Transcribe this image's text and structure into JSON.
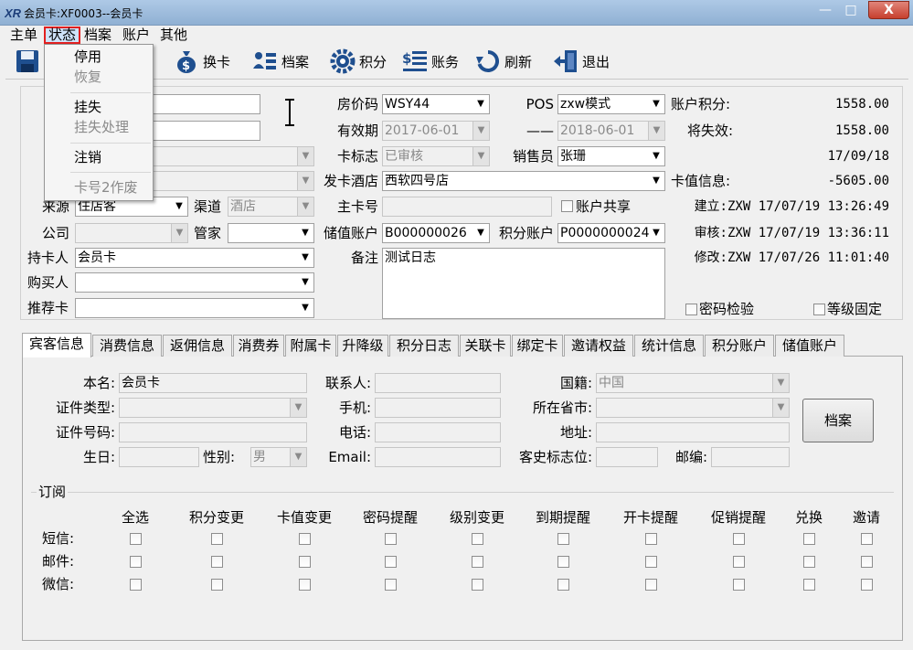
{
  "window": {
    "title": "会员卡:XF0003--会员卡",
    "minimize": "—",
    "maximize": "□",
    "close": "X"
  },
  "menubar": [
    "主单",
    "状态",
    "档案",
    "账户",
    "其他"
  ],
  "status_menu": {
    "items": [
      {
        "label": "停用",
        "enabled": true
      },
      {
        "label": "恢复",
        "enabled": false
      },
      {
        "label": "挂失",
        "enabled": true
      },
      {
        "label": "挂失处理",
        "enabled": false
      },
      {
        "label": "注销",
        "enabled": true
      },
      {
        "label": "卡号2作废",
        "enabled": false
      }
    ]
  },
  "toolbar": [
    {
      "label": "换卡",
      "icon": "money-bag-icon"
    },
    {
      "label": "档案",
      "icon": "profile-list-icon"
    },
    {
      "label": "积分",
      "icon": "gear-points-icon"
    },
    {
      "label": "账务",
      "icon": "dollar-lines-icon"
    },
    {
      "label": "刷新",
      "icon": "refresh-icon"
    },
    {
      "label": "退出",
      "icon": "exit-door-icon"
    }
  ],
  "form": {
    "source_label": "来源",
    "source_value": "住店客",
    "channel_label": "渠道",
    "channel_value": "酒店",
    "company_label": "公司",
    "company_value": "",
    "manager_label": "管家",
    "manager_value": "",
    "holder_label": "持卡人",
    "holder_value": "会员卡",
    "buyer_label": "购买人",
    "buyer_value": "",
    "referrer_label": "推荐卡",
    "referrer_value": "",
    "rate_code_label": "房价码",
    "rate_code_value": "WSY44",
    "pos_label": "POS",
    "pos_value": "zxw模式",
    "validity_label": "有效期",
    "validity_from": "2017-06-01",
    "validity_sep": "——",
    "validity_to": "2018-06-01",
    "card_flag_label": "卡标志",
    "card_flag_value": "已审核",
    "salesman_label": "销售员",
    "salesman_value": "张珊",
    "issuing_hotel_label": "发卡酒店",
    "issuing_hotel_value": "西软四号店",
    "main_card_label": "主卡号",
    "main_card_value": "",
    "account_share_label": "账户共享",
    "stored_account_label": "储值账户",
    "stored_account_value": "B000000026",
    "points_account_label": "积分账户",
    "points_account_value": "P0000000024",
    "remark_label": "备注",
    "remark_value": "测试日志"
  },
  "info": {
    "points_label": "账户积分:",
    "points_value": "1558.00",
    "expiring_label": "将失效:",
    "expiring_value": "1558.00",
    "expire_date": "17/09/18",
    "stored_label": "卡值信息:",
    "stored_value": "-5605.00",
    "created": "建立:ZXW 17/07/19 13:26:49",
    "audited": "审核:ZXW 17/07/19 13:36:11",
    "modified": "修改:ZXW 17/07/26 11:01:40",
    "password_check": "密码检验",
    "level_fixed": "等级固定"
  },
  "tabs": [
    "宾客信息",
    "消费信息",
    "返佣信息",
    "消费券",
    "附属卡",
    "升降级",
    "积分日志",
    "关联卡",
    "绑定卡",
    "邀请权益",
    "统计信息",
    "积分账户",
    "储值账户"
  ],
  "guest": {
    "name_label": "本名:",
    "name_value": "会员卡",
    "contact_label": "联系人:",
    "nationality_label": "国籍:",
    "nationality_value": "中国",
    "id_type_label": "证件类型:",
    "mobile_label": "手机:",
    "province_label": "所在省市:",
    "id_no_label": "证件号码:",
    "phone_label": "电话:",
    "address_label": "地址:",
    "birthday_label": "生日:",
    "gender_label": "性别:",
    "gender_value": "男",
    "email_label": "Email:",
    "history_flag_label": "客史标志位:",
    "zip_label": "邮编:",
    "archive_button": "档案"
  },
  "subscribe": {
    "title": "订阅",
    "columns": [
      "全选",
      "积分变更",
      "卡值变更",
      "密码提醒",
      "级别变更",
      "到期提醒",
      "开卡提醒",
      "促销提醒",
      "兑换",
      "邀请"
    ],
    "rows": [
      "短信:",
      "邮件:",
      "微信:"
    ]
  }
}
